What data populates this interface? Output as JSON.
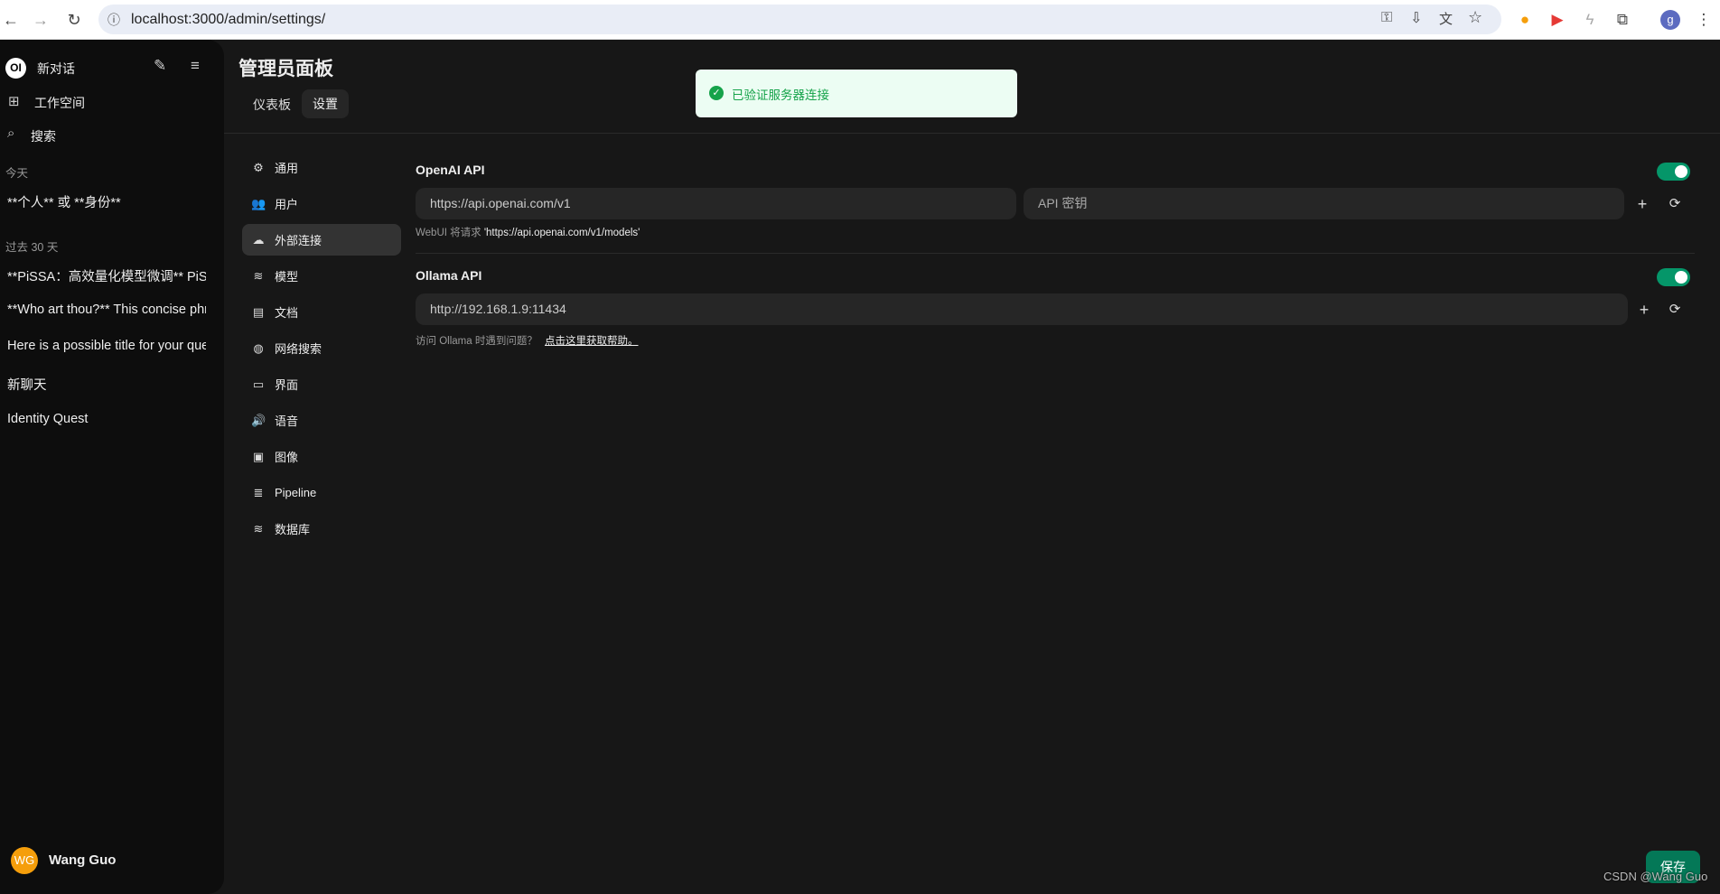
{
  "browser": {
    "url": "localhost:3000/admin/settings/",
    "profile_initial": "g"
  },
  "sidebar": {
    "new_chat": "新对话",
    "workspace": "工作空间",
    "search": "搜索",
    "logo": "OI",
    "groups": [
      {
        "label": "今天",
        "items": [
          "**个人** 或 **身份**"
        ]
      },
      {
        "label": "过去 30 天",
        "items": [
          "**PiSSA：高效量化模型微调** PiSSA",
          "**Who art thou?** This concise phrase",
          "Here is a possible title for your query",
          "新聊天",
          "Identity Quest"
        ]
      }
    ],
    "user": {
      "initials": "WG",
      "name": "Wang Guo"
    }
  },
  "header": {
    "title": "管理员面板",
    "tabs": [
      "仪表板",
      "设置"
    ],
    "active_tab": "设置"
  },
  "toast": {
    "message": "已验证服务器连接",
    "color": "#16a34a"
  },
  "settings_nav": [
    {
      "label": "通用",
      "icon": "gear-icon",
      "glyph": "⚙"
    },
    {
      "label": "用户",
      "icon": "users-icon",
      "glyph": "👥"
    },
    {
      "label": "外部连接",
      "icon": "cloud-icon",
      "glyph": "☁",
      "active": true
    },
    {
      "label": "模型",
      "icon": "database-icon",
      "glyph": "≋"
    },
    {
      "label": "文档",
      "icon": "document-icon",
      "glyph": "▤"
    },
    {
      "label": "网络搜索",
      "icon": "globe-icon",
      "glyph": "◍"
    },
    {
      "label": "界面",
      "icon": "monitor-icon",
      "glyph": "▭"
    },
    {
      "label": "语音",
      "icon": "speaker-icon",
      "glyph": "🔊"
    },
    {
      "label": "图像",
      "icon": "image-icon",
      "glyph": "▣"
    },
    {
      "label": "Pipeline",
      "icon": "layers-icon",
      "glyph": "≣"
    },
    {
      "label": "数据库",
      "icon": "database-icon",
      "glyph": "≋"
    }
  ],
  "openai": {
    "title": "OpenAI API",
    "enabled": true,
    "url": "https://api.openai.com/v1",
    "key_placeholder": "API 密钥",
    "hint_prefix": "WebUI 将请求 ",
    "hint_url": "'https://api.openai.com/v1/models'"
  },
  "ollama": {
    "title": "Ollama API",
    "enabled": true,
    "url": "http://192.168.1.9:11434",
    "hint": "访问 Ollama 时遇到问题？",
    "help_link": "点击这里获取帮助。"
  },
  "save_label": "保存",
  "watermark": "CSDN @Wang Guo",
  "accent": "#059669"
}
